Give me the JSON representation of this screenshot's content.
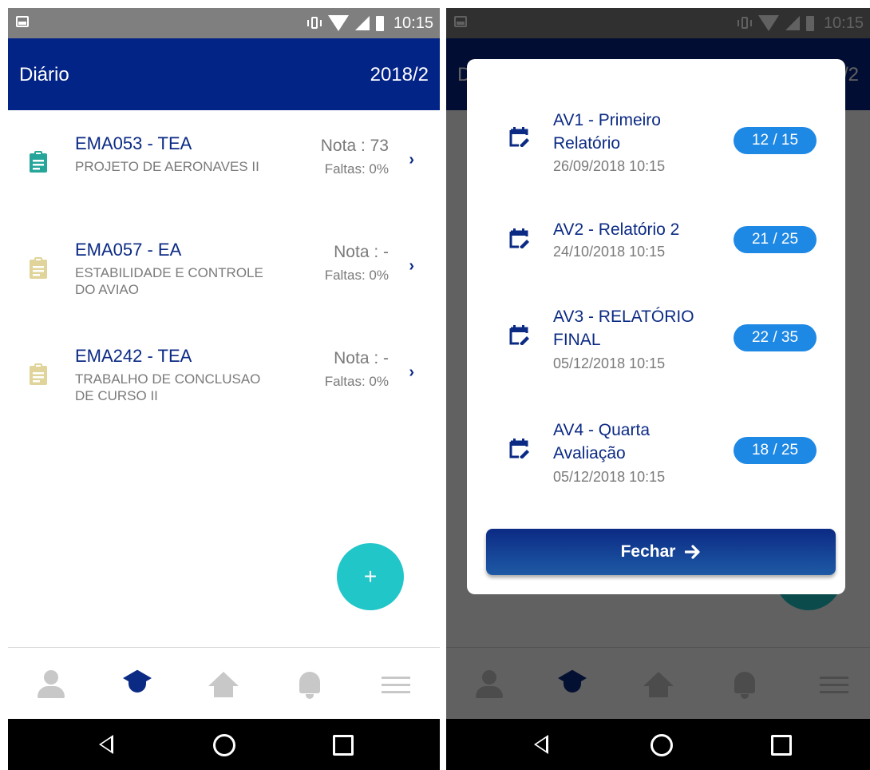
{
  "status_bar": {
    "time": "10:15"
  },
  "app_bar": {
    "title": "Diário",
    "term": "2018/2"
  },
  "courses": [
    {
      "code": "EMA053 - TEA",
      "name": "PROJETO DE AERONAVES II",
      "grade": "Nota : 73",
      "absences": "Faltas: 0%",
      "icon_color": "#26a69a"
    },
    {
      "code": "EMA057 - EA",
      "name": "ESTABILIDADE E CONTROLE DO AVIAO",
      "grade": "Nota : -",
      "absences": "Faltas: 0%",
      "icon_color": "#e0d49a"
    },
    {
      "code": "EMA242 - TEA",
      "name": "TRABALHO DE CONCLUSAO DE CURSO II",
      "grade": "Nota : -",
      "absences": "Faltas: 0%",
      "icon_color": "#e0d49a"
    }
  ],
  "fab": {
    "label": "+"
  },
  "bottom_nav": [
    "person-icon",
    "graduation-cap-icon",
    "home-icon",
    "bell-icon",
    "menu-icon"
  ],
  "dialog": {
    "evaluations": [
      {
        "title": "AV1 - Primeiro Relatório",
        "date": "26/09/2018 10:15",
        "score": "12 / 15"
      },
      {
        "title": "AV2 - Relatório 2",
        "date": "24/10/2018 10:15",
        "score": "21 / 25"
      },
      {
        "title": "AV3 - RELATÓRIO FINAL",
        "date": "05/12/2018 10:15",
        "score": "22 / 35"
      },
      {
        "title": "AV4 - Quarta Avaliação",
        "date": "05/12/2018 10:15",
        "score": "18 / 25"
      }
    ],
    "close_label": "Fechar"
  },
  "colors": {
    "primary": "#032487",
    "accent": "#21c6c8",
    "badge": "#1e88e5"
  }
}
